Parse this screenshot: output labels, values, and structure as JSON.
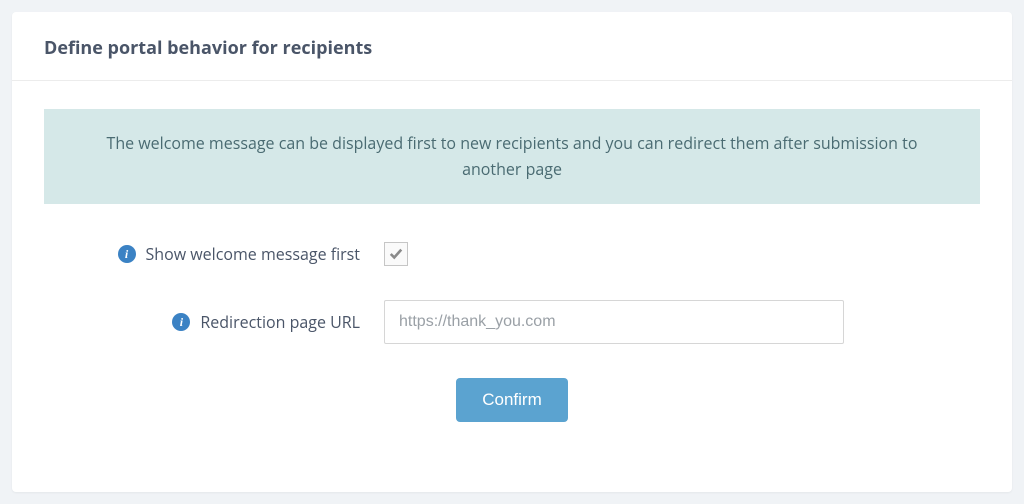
{
  "header": {
    "title": "Define portal behavior for recipients"
  },
  "banner": {
    "text": "The welcome message can be displayed first to new recipients and you can redirect them after submission to another page"
  },
  "form": {
    "show_welcome": {
      "label": "Show welcome message first",
      "checked": true
    },
    "redirect": {
      "label": "Redirection page URL",
      "placeholder": "https://thank_you.com",
      "value": ""
    },
    "confirm_label": "Confirm"
  }
}
